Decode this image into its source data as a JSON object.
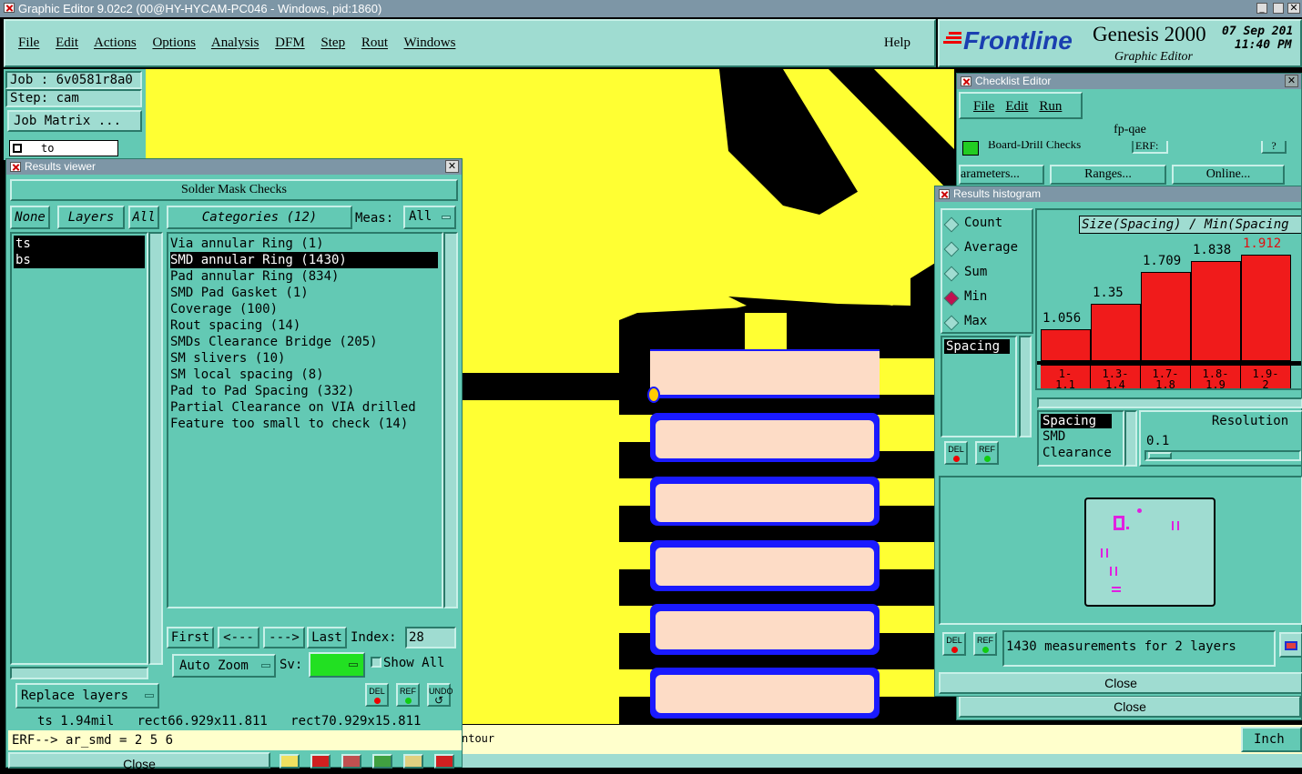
{
  "window_title": "Graphic Editor 9.02c2 (00@HY-HYCAM-PC046 - Windows, pid:1860)",
  "menu": [
    "File",
    "Edit",
    "Actions",
    "Options",
    "Analysis",
    "DFM",
    "Step",
    "Rout",
    "Windows"
  ],
  "help_label": "Help",
  "brand": {
    "logo": "Frontline",
    "product": "Genesis 2000",
    "subtitle": "Graphic Editor",
    "date": "07 Sep 201",
    "time": "11:40 PM"
  },
  "left_panel": {
    "job": "Job : 6v0581r8a0",
    "step": "Step: cam",
    "job_matrix": "Job Matrix ...",
    "layer_field": "to"
  },
  "results_viewer": {
    "title": "Results viewer",
    "header": "Solder Mask Checks",
    "none_label": "None",
    "layers_label": "Layers",
    "all_label": "All",
    "categories_label": "Categories (12)",
    "meas_label": "Meas:",
    "meas_value": "All",
    "layers": [
      "ts",
      "bs"
    ],
    "categories": [
      "Via annular Ring (1)",
      "SMD annular Ring (1430)",
      "Pad annular Ring (834)",
      "SMD Pad Gasket (1)",
      "Coverage (100)",
      "Rout spacing (14)",
      "SMDs Clearance Bridge (205)",
      "SM slivers (10)",
      "SM local spacing (8)",
      "Pad to Pad Spacing (332)",
      "Partial Clearance on VIA drilled",
      "Feature too small to check (14)"
    ],
    "nav": {
      "first": "First",
      "prev": "<---",
      "next": "--->",
      "last": "Last",
      "index_label": "Index:",
      "index_value": "28"
    },
    "auto_zoom": "Auto Zoom",
    "sv_label": "Sv:",
    "show_all": "Show All",
    "replace_layers": "Replace layers",
    "del": "DEL",
    "ref": "REF",
    "undo": "UNDO",
    "status": "ts 1.94mil   rect66.929x11.811   rect70.929x15.811",
    "erf": "ERF--> ar_smd = 2 5 6",
    "close": "Close"
  },
  "checklist": {
    "title": "Checklist Editor",
    "menu": [
      "File",
      "Edit",
      "Run"
    ],
    "name": "fp-qae",
    "row": "Board-Drill Checks",
    "erf": "ERF:",
    "params": "arameters...",
    "ranges": "Ranges...",
    "online": "Online...",
    "close": "Close"
  },
  "histogram": {
    "title": "Results histogram",
    "modes": [
      "Count",
      "Average",
      "Sum",
      "Min",
      "Max"
    ],
    "selected_mode": "Min",
    "chart_title": "Size(Spacing) / Min(Spacing",
    "attr_list": [
      "Spacing"
    ],
    "attrs2": [
      "Spacing",
      "SMD",
      "Clearance"
    ],
    "resolution_label": "Resolution",
    "resolution_value": "0.1",
    "summary": "1430 measurements for 2 layers",
    "close": "Close",
    "del": "DEL",
    "ref": "REF",
    "status_right": "Inch",
    "status_mid": "ntour"
  },
  "chart_data": {
    "type": "bar",
    "title": "Size(Spacing) / Min(Spacing",
    "categories": [
      "1-1.1",
      "1.3-1.4",
      "1.7-1.8",
      "1.8-1.9",
      "1.9-2"
    ],
    "category_lines": [
      [
        "1-",
        "1.1"
      ],
      [
        "1.3-",
        "1.4"
      ],
      [
        "1.7-",
        "1.8"
      ],
      [
        "1.8-",
        "1.9"
      ],
      [
        "1.9-",
        "2"
      ]
    ],
    "values": [
      1.056,
      1.35,
      1.709,
      1.838,
      1.912
    ],
    "value_labels": [
      "1.056",
      "1.35",
      "1.709",
      "1.838",
      "1.912"
    ],
    "highlight_color": "#e01010",
    "bar_color": "#f01b1b"
  },
  "colors": {
    "panel": "#63c9b4",
    "canvas_yellow": "#ffff33",
    "pad": "#fddcc6",
    "pad_outline": "#1a1aff"
  }
}
